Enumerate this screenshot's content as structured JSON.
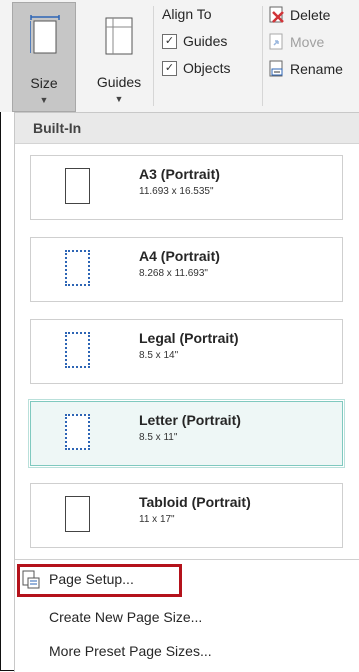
{
  "ribbon": {
    "size_label": "Size",
    "guides_label": "Guides",
    "align_group": {
      "title": "Align To",
      "guides_option": "Guides",
      "objects_option": "Objects",
      "guides_checked": true,
      "objects_checked": true
    },
    "commands": {
      "delete_label": "Delete",
      "move_label": "Move",
      "rename_label": "Rename"
    }
  },
  "dropdown": {
    "section_header": "Built-In",
    "presets": [
      {
        "name": "A3 (Portrait)",
        "dimensions": "11.693 x 16.535\"",
        "icon": "page-portrait-icon",
        "selected": false
      },
      {
        "name": "A4 (Portrait)",
        "dimensions": "8.268 x 11.693\"",
        "icon": "page-portrait-icon",
        "selected": false
      },
      {
        "name": "Legal (Portrait)",
        "dimensions": "8.5 x 14\"",
        "icon": "page-portrait-icon",
        "selected": false
      },
      {
        "name": "Letter (Portrait)",
        "dimensions": "8.5 x 11\"",
        "icon": "page-portrait-icon",
        "selected": true
      },
      {
        "name": "Tabloid (Portrait)",
        "dimensions": "11 x 17\"",
        "icon": "page-portrait-icon",
        "selected": false
      }
    ],
    "menu": {
      "page_setup": "Page Setup...",
      "create_new": "Create New Page Size...",
      "more_presets": "More Preset Page Sizes..."
    }
  },
  "colors": {
    "selected_border": "#7fc9bf",
    "highlight_border": "#b4121b",
    "dotted_icon": "#2d65b5"
  }
}
